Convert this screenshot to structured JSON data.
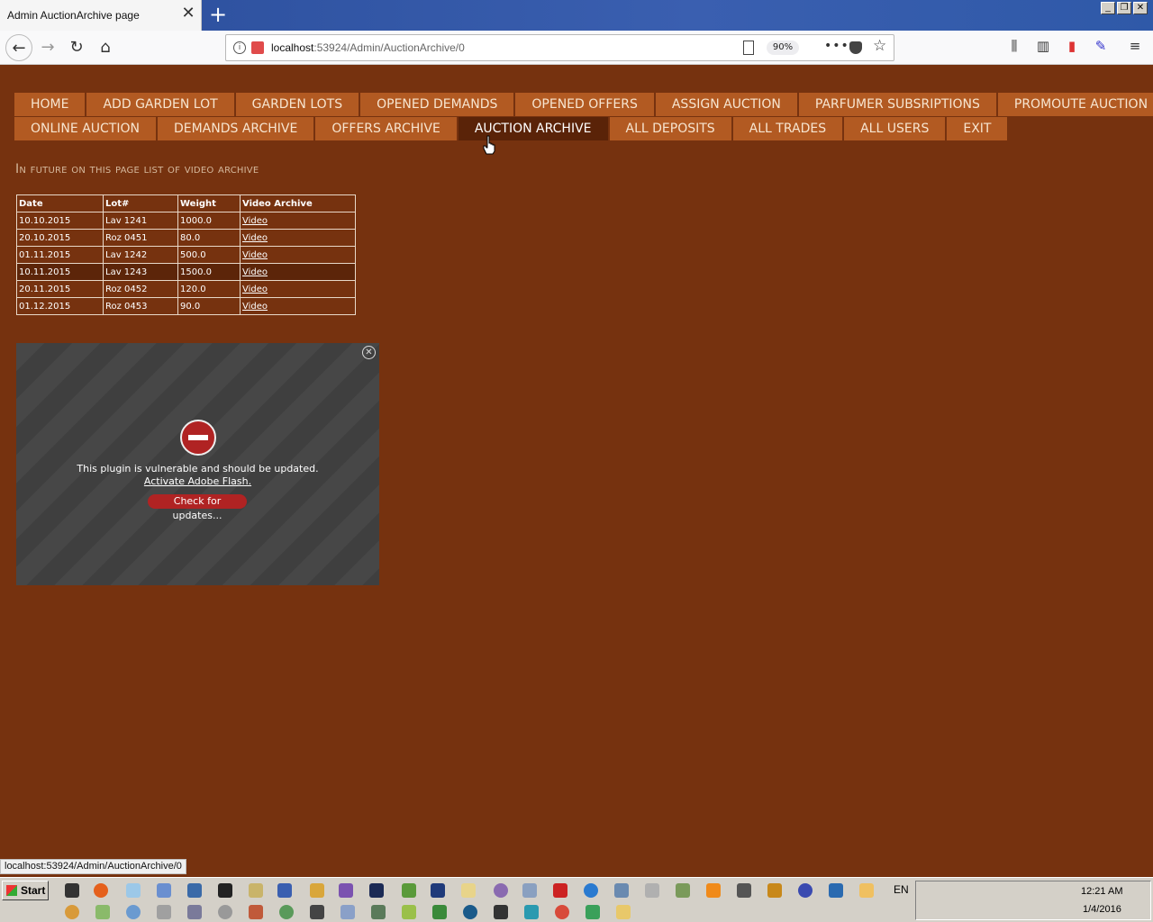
{
  "browser": {
    "tab_title": "Admin AuctionArchive page",
    "url_host": "localhost",
    "url_path": ":53924/Admin/AuctionArchive/0",
    "zoom": "90%",
    "status_url": "localhost:53924/Admin/AuctionArchive/0"
  },
  "menu": {
    "row1": [
      "HOME",
      "ADD GARDEN LOT",
      "GARDEN LOTS",
      "OPENED DEMANDS",
      "OPENED OFFERS",
      "ASSIGN AUCTION",
      "PARFUMER SUBSRIPTIONS",
      "PROMOUTE AUCTION"
    ],
    "row2": [
      "ONLINE AUCTION",
      "DEMANDS ARCHIVE",
      "OFFERS ARCHIVE",
      "AUCTION ARCHIVE",
      "ALL DEPOSITS",
      "ALL TRADES",
      "ALL USERS",
      "EXIT"
    ],
    "active": "AUCTION ARCHIVE"
  },
  "page": {
    "heading": "In future on this page list of video archive"
  },
  "archive": {
    "headers": [
      "Date",
      "Lot#",
      "Weight",
      "Video Archive"
    ],
    "rows": [
      [
        "10.10.2015",
        "Lav 1241",
        "1000.0",
        "Video"
      ],
      [
        "20.10.2015",
        "Roz 0451",
        "80.0",
        "Video"
      ],
      [
        "01.11.2015",
        "Lav 1242",
        "500.0",
        "Video"
      ],
      [
        "10.11.2015",
        "Lav 1243",
        "1500.0",
        "Video"
      ],
      [
        "20.11.2015",
        "Roz 0452",
        "120.0",
        "Video"
      ],
      [
        "01.12.2015",
        "Roz 0453",
        "90.0",
        "Video"
      ]
    ]
  },
  "flash": {
    "message": "This plugin is vulnerable and should be updated.",
    "link": "Activate Adobe Flash.",
    "button": "Check for updates..."
  },
  "taskbar": {
    "start": "Start",
    "lang": "EN",
    "time": "12:21 AM",
    "date": "1/4/2016"
  },
  "colors": {
    "page_bg": "#76320f",
    "menu_item": "#b25a22",
    "menu_active": "#5a2308"
  }
}
